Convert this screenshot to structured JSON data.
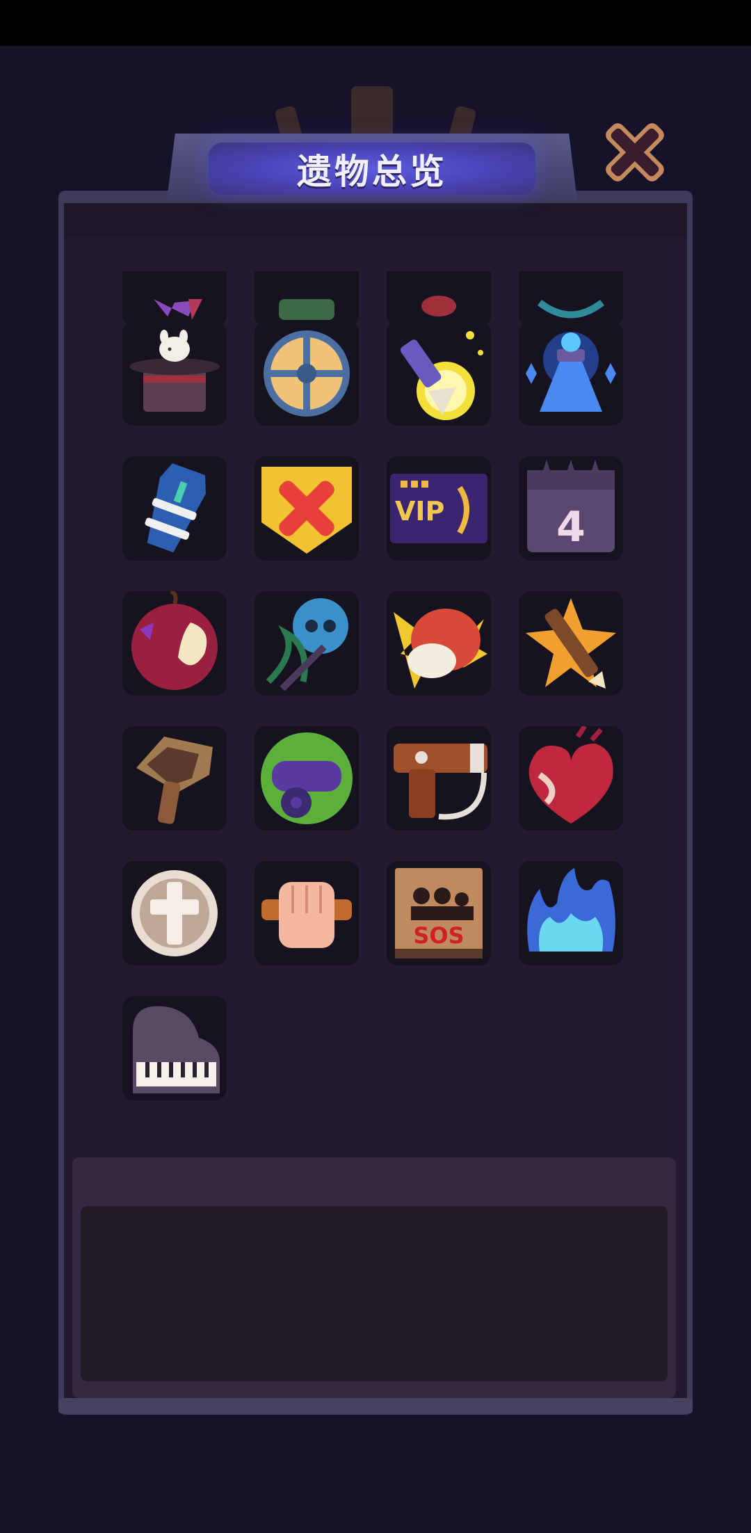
{
  "header": {
    "title": "遗物总览"
  },
  "close_button": {
    "icon": "close-x-icon"
  },
  "relics": {
    "partial_row": [
      {
        "name": "relic-partial-1-icon",
        "color": "#7a3ea0"
      },
      {
        "name": "relic-partial-2-icon",
        "color": "#3d6a45"
      },
      {
        "name": "relic-partial-3-icon",
        "color": "#a0303a"
      },
      {
        "name": "relic-partial-4-icon",
        "color": "#2f8a9a"
      }
    ],
    "rows": [
      [
        "top-hat-rabbit-icon",
        "round-shield-icon",
        "glowing-arrow-icon",
        "blue-potion-flask-icon"
      ],
      [
        "blue-coffin-icon",
        "red-x-shield-badge-icon",
        "vip-card-icon",
        "skull-calendar-icon"
      ],
      [
        "bitten-apple-icon",
        "vine-skull-icon",
        "raw-steak-icon",
        "crossbow-star-icon"
      ],
      [
        "spiked-club-icon",
        "green-cannon-icon",
        "hair-dryer-icon",
        "anatomical-heart-icon"
      ],
      [
        "holy-cross-coin-icon",
        "fist-icon",
        "sos-matchbook-icon",
        "blue-flame-icon"
      ],
      [
        "grand-piano-icon"
      ]
    ],
    "vip_text": "VIP",
    "calendar_number": "4",
    "sos_text": "SOS"
  },
  "description": {
    "text": ""
  }
}
